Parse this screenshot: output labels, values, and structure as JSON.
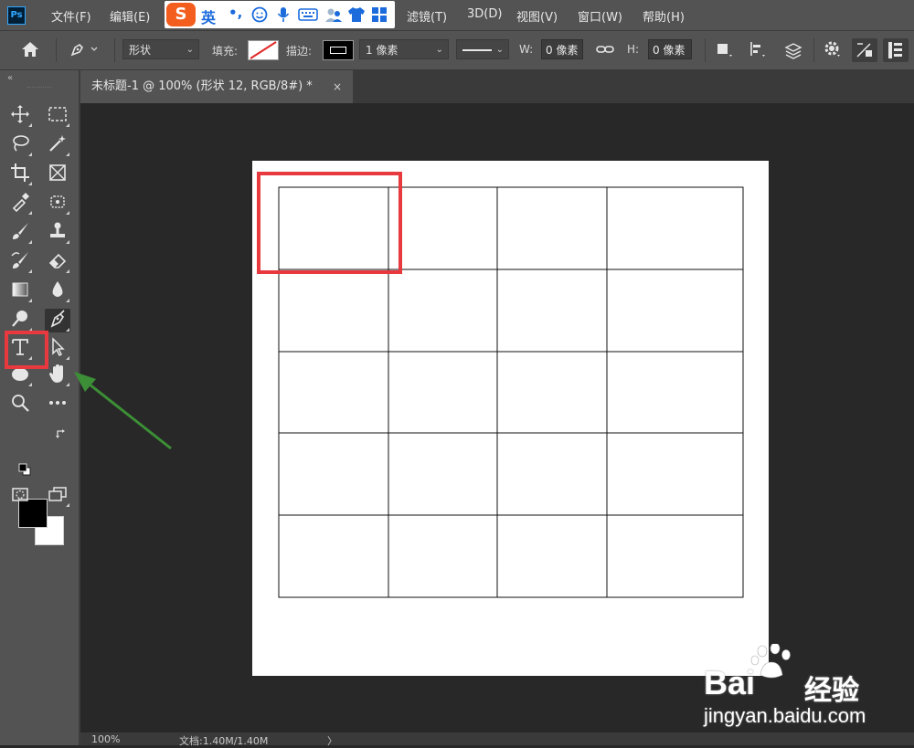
{
  "menubar": {
    "logo": "Ps",
    "items": [
      {
        "label": "文件(F)"
      },
      {
        "label": "编辑(E)"
      },
      {
        "label": "滤镜(T)"
      },
      {
        "label": "3D(D)"
      },
      {
        "label": "视图(V)"
      },
      {
        "label": "窗口(W)"
      },
      {
        "label": "帮助(H)"
      }
    ]
  },
  "ime": {
    "logo": "S",
    "mode": "英",
    "punct": "•,",
    "icons": [
      "smiley-icon",
      "microphone-icon",
      "keyboard-icon",
      "users-icon",
      "shirt-icon",
      "grid-icon"
    ]
  },
  "options": {
    "mode_value": "形状",
    "fill_label": "填充:",
    "stroke_label": "描边:",
    "stroke_width_value": "1 像素",
    "w_label": "W:",
    "w_value": "0 像素",
    "h_label": "H:",
    "h_value": "0 像素"
  },
  "document": {
    "tab_title": "未标题-1 @ 100% (形状 12, RGB/8#) *",
    "close": "×"
  },
  "table_grid": {
    "columns": 4,
    "rows": 5
  },
  "status": {
    "zoom": "100%",
    "doc_info": "文档:1.40M/1.40M",
    "arrow": "〉"
  },
  "watermark": {
    "brand_left": "Bai",
    "brand_right": "经验",
    "url": "jingyan.baidu.com"
  },
  "colors": {
    "highlight": "#e8393f",
    "arrow": "#3c8f36",
    "foreground": "#000000",
    "background": "#ffffff"
  }
}
